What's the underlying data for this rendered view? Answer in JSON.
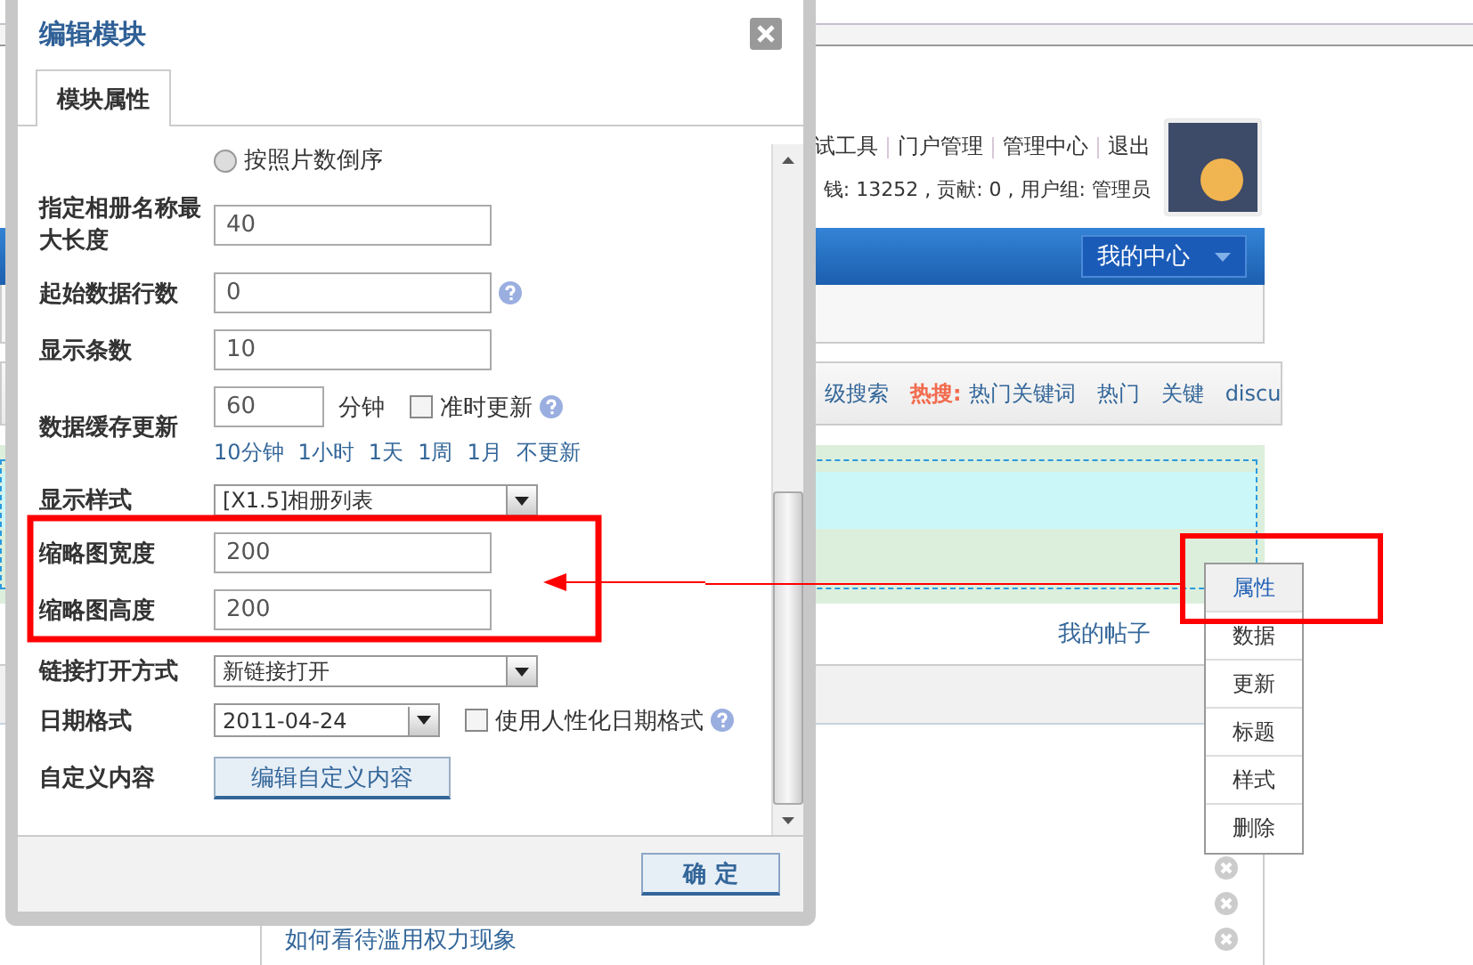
{
  "background_page": {
    "top_links": [
      "试工具",
      "门户管理",
      "管理中心",
      "退出"
    ],
    "user_stats": "钱: 13252 , 贡献: 0 , 用户组: 管理员",
    "nav": {
      "menu_button": "我的中心"
    },
    "search_bar": {
      "partial_link": "级搜索",
      "hot_label": "热搜:",
      "hot_links": [
        "热门关键词",
        "热门",
        "关键",
        "discu"
      ]
    },
    "post_links": [
      "我的帖子"
    ],
    "list_items": [
      "如何看待滥用权力现象"
    ]
  },
  "dialog": {
    "title": "编辑模块",
    "tabs": [
      {
        "label": "模块属性",
        "selected": true
      }
    ],
    "form_rows": [
      {
        "kind": "radio",
        "option": "按照片数倒序",
        "checked": false
      },
      {
        "kind": "text",
        "label": "指定相册名称最大长度",
        "value": "40"
      },
      {
        "kind": "text",
        "label": "起始数据行数",
        "value": "0",
        "help": true
      },
      {
        "kind": "text",
        "label": "显示条数",
        "value": "10"
      },
      {
        "kind": "cache",
        "label": "数据缓存更新",
        "value": "60",
        "unit": "分钟",
        "checkbox": {
          "label": "准时更新",
          "checked": false
        },
        "help": true,
        "presets": [
          "10分钟",
          "1小时",
          "1天",
          "1周",
          "1月",
          "不更新"
        ]
      },
      {
        "kind": "select",
        "label": "显示样式",
        "value": "[X1.5]相册列表"
      },
      {
        "kind": "text",
        "label": "缩略图宽度",
        "value": "200"
      },
      {
        "kind": "text",
        "label": "缩略图高度",
        "value": "200"
      },
      {
        "kind": "select",
        "label": "链接打开方式",
        "value": "新链接打开"
      },
      {
        "kind": "date",
        "label": "日期格式",
        "value": "2011-04-24",
        "checkbox": {
          "label": "使用人性化日期格式",
          "checked": false
        },
        "help": true
      },
      {
        "kind": "button",
        "label": "自定义内容",
        "button": "编辑自定义内容"
      }
    ],
    "confirm_button": "确 定"
  },
  "context_menu": {
    "items": [
      {
        "label": "属性",
        "selected": true
      },
      {
        "label": "数据",
        "selected": false
      },
      {
        "label": "更新",
        "selected": false
      },
      {
        "label": "标题",
        "selected": false
      },
      {
        "label": "样式",
        "selected": false
      },
      {
        "label": "删除",
        "selected": false
      }
    ]
  }
}
